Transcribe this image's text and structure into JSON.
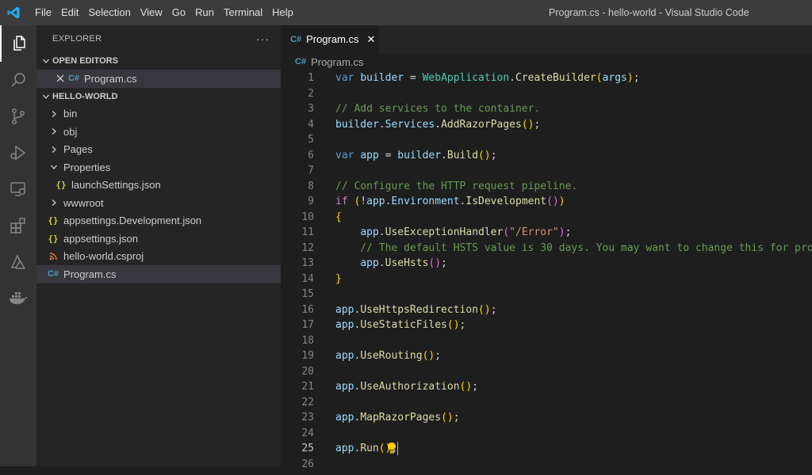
{
  "window": {
    "title": "Program.cs - hello-world - Visual Studio Code",
    "logo_icon": "vscode-logo-icon"
  },
  "menu": [
    "File",
    "Edit",
    "Selection",
    "View",
    "Go",
    "Run",
    "Terminal",
    "Help"
  ],
  "activity_bar": {
    "items": [
      "explorer-icon",
      "search-icon",
      "source-control-icon",
      "run-debug-icon",
      "remote-explorer-icon",
      "extensions-icon",
      "azure-icon",
      "docker-icon"
    ],
    "active": "explorer-icon"
  },
  "sidebar": {
    "title": "EXPLORER",
    "more_actions": "···",
    "open_editors": {
      "label": "OPEN EDITORS",
      "items": [
        {
          "name": "Program.cs",
          "close_icon": "close-icon",
          "file_icon": "csharp-file-icon"
        }
      ]
    },
    "workspace": {
      "label": "HELLO-WORLD",
      "tree": [
        {
          "name": "bin",
          "kind": "folder",
          "expanded": false
        },
        {
          "name": "obj",
          "kind": "folder",
          "expanded": false
        },
        {
          "name": "Pages",
          "kind": "folder",
          "expanded": false
        },
        {
          "name": "Properties",
          "kind": "folder",
          "expanded": true
        },
        {
          "name": "launchSettings.json",
          "kind": "json-file",
          "parent": "Properties"
        },
        {
          "name": "wwwroot",
          "kind": "folder",
          "expanded": false
        },
        {
          "name": "appsettings.Development.json",
          "kind": "json-file"
        },
        {
          "name": "appsettings.json",
          "kind": "json-file"
        },
        {
          "name": "hello-world.csproj",
          "kind": "rss-file"
        },
        {
          "name": "Program.cs",
          "kind": "csharp-file",
          "selected": true
        }
      ]
    }
  },
  "editor": {
    "tab": {
      "label": "Program.cs",
      "close_label": "✕"
    },
    "breadcrumb": "Program.cs",
    "file_icon_glyph": "C#",
    "current_line": "25",
    "lightbulb_line": "24",
    "lines": [
      {
        "n": "1",
        "text": "var builder = WebApplication.CreateBuilder(args);"
      },
      {
        "n": "2",
        "text": ""
      },
      {
        "n": "3",
        "text": "// Add services to the container."
      },
      {
        "n": "4",
        "text": "builder.Services.AddRazorPages();"
      },
      {
        "n": "5",
        "text": ""
      },
      {
        "n": "6",
        "text": "var app = builder.Build();"
      },
      {
        "n": "7",
        "text": ""
      },
      {
        "n": "8",
        "text": "// Configure the HTTP request pipeline."
      },
      {
        "n": "9",
        "text": "if (!app.Environment.IsDevelopment())"
      },
      {
        "n": "10",
        "text": "{"
      },
      {
        "n": "11",
        "text": "    app.UseExceptionHandler(\"/Error\");"
      },
      {
        "n": "12",
        "text": "    // The default HSTS value is 30 days. You may want to change this for pro"
      },
      {
        "n": "13",
        "text": "    app.UseHsts();"
      },
      {
        "n": "14",
        "text": "}"
      },
      {
        "n": "15",
        "text": ""
      },
      {
        "n": "16",
        "text": "app.UseHttpsRedirection();"
      },
      {
        "n": "17",
        "text": "app.UseStaticFiles();"
      },
      {
        "n": "18",
        "text": ""
      },
      {
        "n": "19",
        "text": "app.UseRouting();"
      },
      {
        "n": "20",
        "text": ""
      },
      {
        "n": "21",
        "text": "app.UseAuthorization();"
      },
      {
        "n": "22",
        "text": ""
      },
      {
        "n": "23",
        "text": "app.MapRazorPages();"
      },
      {
        "n": "24",
        "text": ""
      },
      {
        "n": "25",
        "text": "app.Run();"
      },
      {
        "n": "26",
        "text": ""
      }
    ]
  },
  "colors": {
    "titlebar": "#3c3c3c",
    "activity_bar": "#333333",
    "sidebar": "#252526",
    "editor_bg": "#1e1e1e",
    "selection": "#37373d",
    "keyword": "#569cd6",
    "variable": "#9cdcfe",
    "type": "#4ec9b0",
    "function": "#dcdcaa",
    "string": "#ce9178",
    "comment": "#6a9955"
  }
}
